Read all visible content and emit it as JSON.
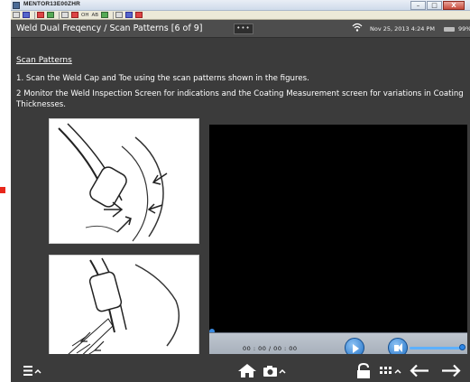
{
  "window": {
    "title": "MENTOR13E00ZHR",
    "controls": {
      "minimize": "–",
      "maximize": "□",
      "close": "X"
    }
  },
  "toolbar": {
    "text_a": "OH",
    "text_b": "AB"
  },
  "header": {
    "breadcrumb": "Weld Dual Freqency  /  Scan Patterns  [6 of 9]",
    "menu_dots": "•••",
    "date": "Nov 25, 2013  4:24 PM",
    "battery_pct": "99%"
  },
  "content": {
    "heading": "Scan Patterns",
    "step1": "1. Scan the Weld Cap and Toe using the scan patterns shown in the figures.",
    "step2": "2 Monitor the Weld Inspection Screen for indications and the Coating Measurement screen for variations in Coating Thicknesses."
  },
  "video": {
    "timecode": "00 : 00 / 00 : 00",
    "progress": 0,
    "volume": 0.95
  },
  "colors": {
    "app_background": "#3b3b3b",
    "header_background": "#4d4d4d",
    "accent_blue": "#2d86e6"
  },
  "icons": {
    "menu": "menu-icon",
    "home": "home-icon",
    "camera": "camera-icon",
    "lock": "lock-icon",
    "grid": "grid-icon",
    "back": "arrow-left-icon",
    "forward": "arrow-right-icon"
  }
}
